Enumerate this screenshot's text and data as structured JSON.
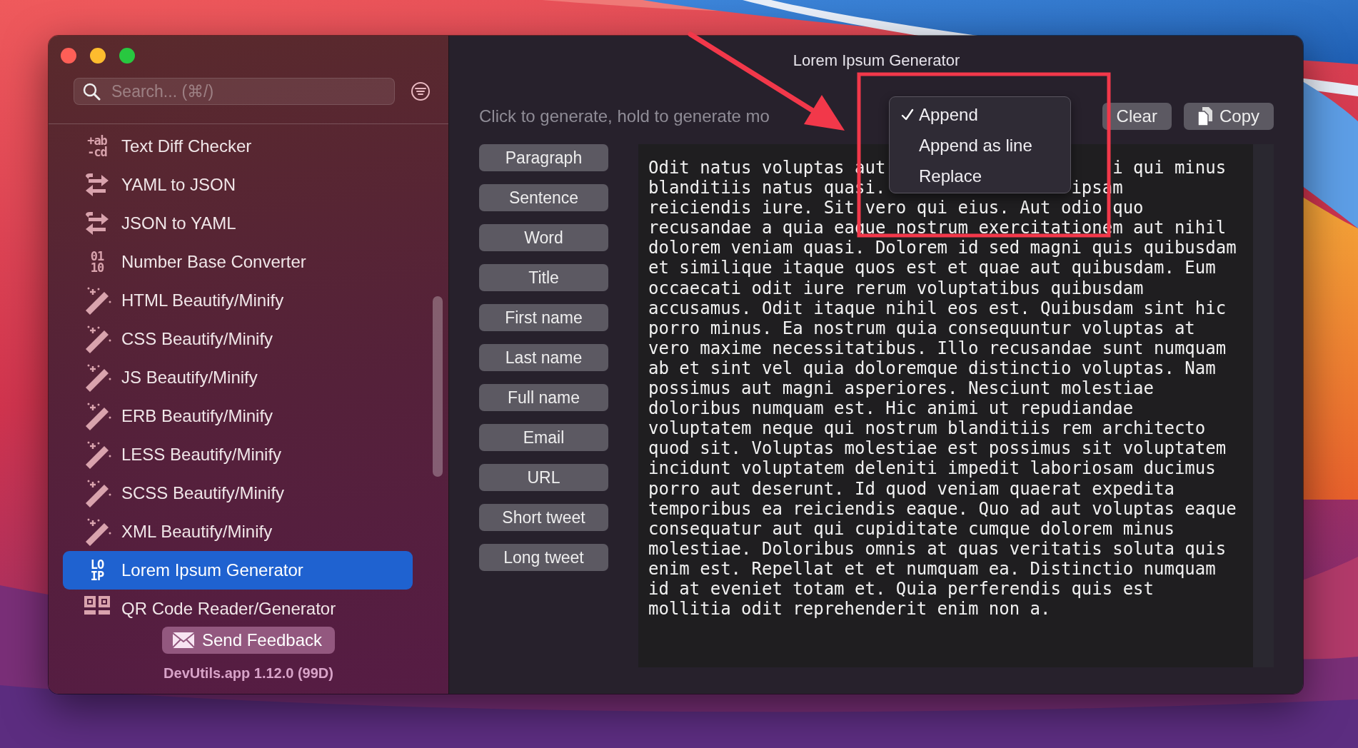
{
  "window": {
    "title": "Lorem Ipsum Generator"
  },
  "sidebar": {
    "search": {
      "placeholder": "Search... (⌘/)"
    },
    "items": [
      {
        "label": "Text Diff Checker",
        "kind": "glyph",
        "glyph": [
          "+ab",
          "-cd"
        ],
        "selected": false
      },
      {
        "label": "YAML to JSON",
        "kind": "swap",
        "selected": false
      },
      {
        "label": "JSON to YAML",
        "kind": "swap",
        "selected": false
      },
      {
        "label": "Number Base Converter",
        "kind": "glyph",
        "glyph": [
          "01",
          "10"
        ],
        "selected": false
      },
      {
        "label": "HTML Beautify/Minify",
        "kind": "wand",
        "selected": false
      },
      {
        "label": "CSS Beautify/Minify",
        "kind": "wand",
        "selected": false
      },
      {
        "label": "JS Beautify/Minify",
        "kind": "wand",
        "selected": false
      },
      {
        "label": "ERB Beautify/Minify",
        "kind": "wand",
        "selected": false
      },
      {
        "label": "LESS Beautify/Minify",
        "kind": "wand",
        "selected": false
      },
      {
        "label": "SCSS Beautify/Minify",
        "kind": "wand",
        "selected": false
      },
      {
        "label": "XML Beautify/Minify",
        "kind": "wand",
        "selected": false
      },
      {
        "label": "Lorem Ipsum Generator",
        "kind": "glyph",
        "glyph": [
          "LO",
          "IP"
        ],
        "selected": true
      },
      {
        "label": "QR Code Reader/Generator",
        "kind": "qr",
        "selected": false
      }
    ],
    "feedback_button": "Send Feedback",
    "version": "DevUtils.app 1.12.0 (99D)"
  },
  "main": {
    "hint": "Click to generate, hold to generate mo",
    "actions": [
      {
        "label": "Clear",
        "kind": "plain"
      },
      {
        "label": "Copy",
        "kind": "copy"
      }
    ],
    "generators": [
      "Paragraph",
      "Sentence",
      "Word",
      "Title",
      "First name",
      "Last name",
      "Full name",
      "Email",
      "URL",
      "Short tweet",
      "Long tweet"
    ],
    "output_lines": [
      [
        "Odit natus voluptas aut",
        "i qui minus"
      ],
      [
        "blanditiis natus quasi.",
        "ipsam"
      ],
      [
        "reiciendis iure. Sit vero qui eius. Aut odio quo"
      ],
      [
        "recusandae a quia eaque nostrum exercitationem aut nihil"
      ],
      [
        "dolorem veniam quasi. Dolorem id sed magni quis quibusdam"
      ],
      [
        "et similique itaque quos est et quae aut quibusdam. Eum"
      ],
      [
        "occaecati odit iure rerum voluptatibus quibusdam"
      ],
      [
        "accusamus. Odit itaque nihil eos est. Quibusdam sint hic"
      ],
      [
        "porro minus. Ea nostrum quia consequuntur voluptas at"
      ],
      [
        "vero maxime necessitatibus. Illo recusandae sunt numquam"
      ],
      [
        "ab et sint vel quia doloremque distinctio voluptas. Nam"
      ],
      [
        "possimus aut magni asperiores. Nesciunt molestiae"
      ],
      [
        "doloribus numquam est. Hic animi ut repudiandae"
      ],
      [
        "voluptatem neque qui nostrum blanditiis rem architecto"
      ],
      [
        "quod sit. Voluptas molestiae est possimus sit voluptatem"
      ],
      [
        "incidunt voluptatem deleniti impedit laboriosam ducimus"
      ],
      [
        "porro aut deserunt. Id quod veniam quaerat expedita"
      ],
      [
        "temporibus ea reiciendis eaque. Quo ad aut voluptas eaque"
      ],
      [
        "consequatur aut qui cupiditate cumque dolorem minus"
      ],
      [
        "molestiae. Doloribus omnis at quas veritatis soluta quis"
      ],
      [
        "enim est. Repellat et et numquam ea. Distinctio numquam"
      ],
      [
        "id at eveniet totam et. Quia perferendis quis est"
      ],
      [
        "mollitia odit reprehenderit enim non a."
      ]
    ]
  },
  "menu": {
    "items": [
      {
        "label": "Append",
        "selected": true
      },
      {
        "label": "Append as line",
        "selected": false
      },
      {
        "label": "Replace",
        "selected": false
      }
    ]
  },
  "annotations": {
    "arrow": true,
    "highlight_box": true
  }
}
